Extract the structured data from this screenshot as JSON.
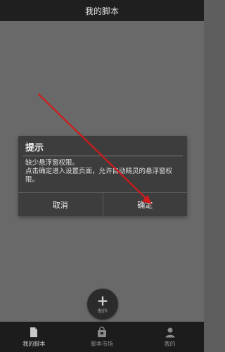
{
  "header": {
    "title": "我的脚本"
  },
  "fab": {
    "label": "制作",
    "icon": "plus-icon"
  },
  "dialog": {
    "title": "提示",
    "message_line1": "缺少悬浮窗权限。",
    "message_line2": "点击确定进入设置页面，允许自动精灵的悬浮窗权限。",
    "cancel_label": "取消",
    "confirm_label": "确定"
  },
  "bottom_nav": [
    {
      "label": "我的脚本",
      "icon": "document-icon",
      "active": true
    },
    {
      "label": "脚本市场",
      "icon": "market-bag-icon",
      "active": false
    },
    {
      "label": "我的",
      "icon": "person-icon",
      "active": false
    }
  ],
  "colors": {
    "overlay": "#696969",
    "dialog_bg": "#3d3d3d",
    "bar_bg": "#1f1f1f",
    "annotation_arrow": "#d11a1a"
  }
}
